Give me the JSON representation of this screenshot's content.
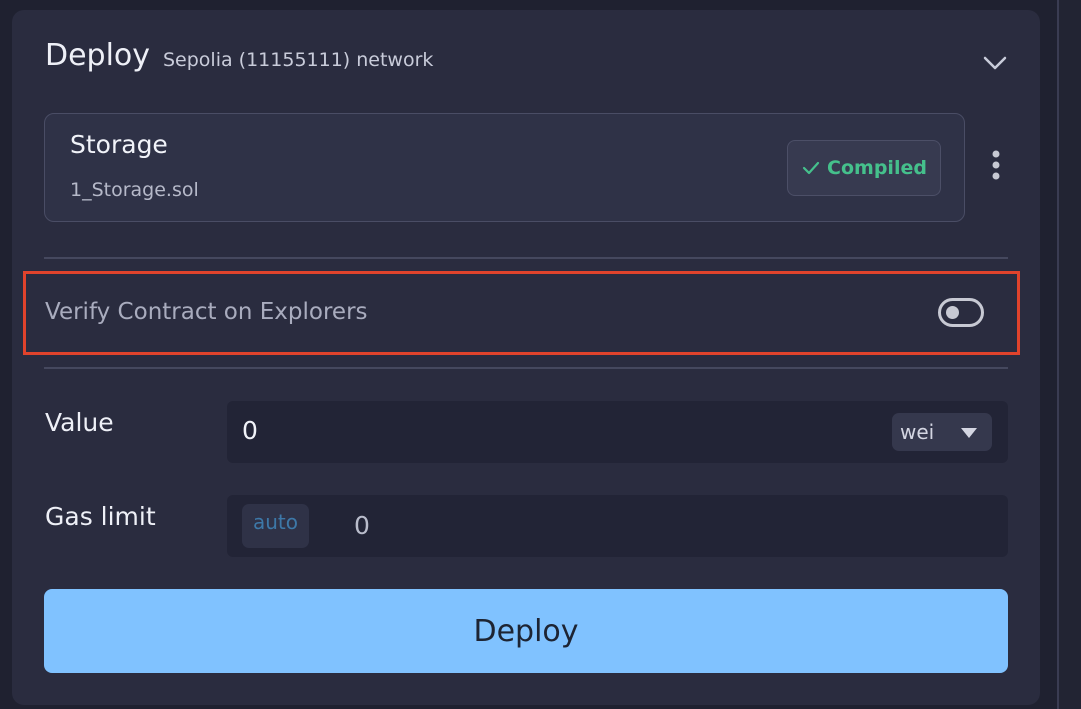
{
  "header": {
    "title": "Deploy",
    "network": "Sepolia (11155111) network"
  },
  "contract": {
    "name": "Storage",
    "file": "1_Storage.sol",
    "status": "Compiled"
  },
  "verify": {
    "label": "Verify Contract on Explorers",
    "enabled": false
  },
  "value": {
    "label": "Value",
    "amount": "0",
    "unit": "wei"
  },
  "gas": {
    "label": "Gas limit",
    "mode": "auto",
    "amount": "0"
  },
  "deploy": {
    "label": "Deploy",
    "color": "#80c2ff"
  },
  "colors": {
    "compiled": "#45c08c",
    "highlight": "#e0432c"
  },
  "icons": [
    "chevron-down-icon",
    "check-icon",
    "kebab-menu-icon",
    "caret-down-icon"
  ]
}
